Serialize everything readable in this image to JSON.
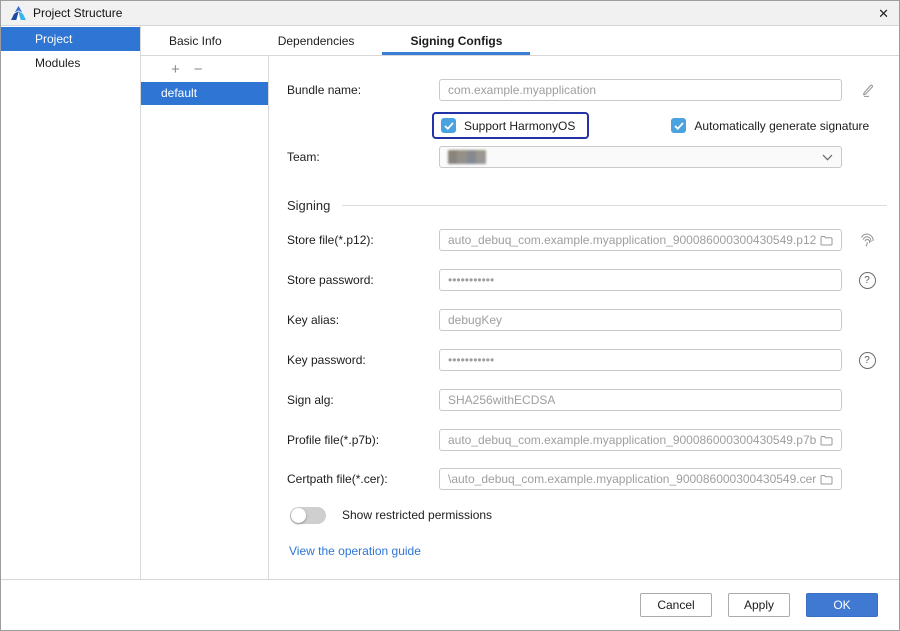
{
  "window": {
    "title": "Project Structure",
    "close_glyph": "✕"
  },
  "sidebar": {
    "items": [
      {
        "label": "Project",
        "selected": true
      },
      {
        "label": "Modules",
        "selected": false
      }
    ]
  },
  "tabs": [
    {
      "label": "Basic Info",
      "selected": false
    },
    {
      "label": "Dependencies",
      "selected": false
    },
    {
      "label": "Signing Configs",
      "selected": true
    }
  ],
  "config_list": {
    "add_glyph": "+",
    "remove_glyph": "−",
    "items": [
      {
        "label": "default",
        "selected": true
      }
    ]
  },
  "form": {
    "bundle_name": {
      "label": "Bundle name:",
      "value": "com.example.myapplication"
    },
    "support_harmonyos": {
      "label": "Support HarmonyOS",
      "checked": true
    },
    "auto_generate": {
      "label": "Automatically generate signature",
      "checked": true
    },
    "team": {
      "label": "Team:"
    },
    "signing_section": {
      "title": "Signing"
    },
    "store_file": {
      "label": "Store file(*.p12):",
      "value": "auto_debuq_com.example.myapplication_900086000300430549.p12"
    },
    "store_password": {
      "label": "Store password:",
      "value": "•••••••••••"
    },
    "key_alias": {
      "label": "Key alias:",
      "value": "debugKey"
    },
    "key_password": {
      "label": "Key password:",
      "value": "•••••••••••"
    },
    "sign_alg": {
      "label": "Sign alg:",
      "value": "SHA256withECDSA"
    },
    "profile_file": {
      "label": "Profile file(*.p7b):",
      "value": "auto_debuq_com.example.myapplication_900086000300430549.p7b"
    },
    "certpath_file": {
      "label": "Certpath file(*.cer):",
      "value": "\\auto_debuq_com.example.myapplication_900086000300430549.cer"
    },
    "restricted_permissions": {
      "label": "Show restricted permissions",
      "enabled": false
    },
    "guide_link": {
      "label": "View the operation guide"
    },
    "help_glyph": "?"
  },
  "footer": {
    "buttons": [
      {
        "label": "Cancel"
      },
      {
        "label": "Apply"
      },
      {
        "label": "OK",
        "primary": true
      }
    ]
  },
  "colors": {
    "accent": "#2e75d4",
    "tab_underline": "#3a7fd9",
    "checkbox_blue": "#4aa2e0",
    "focus_ring_blue": "#2432a8",
    "ok_button_blue": "#4079d1",
    "link_blue": "#2e75d4"
  }
}
